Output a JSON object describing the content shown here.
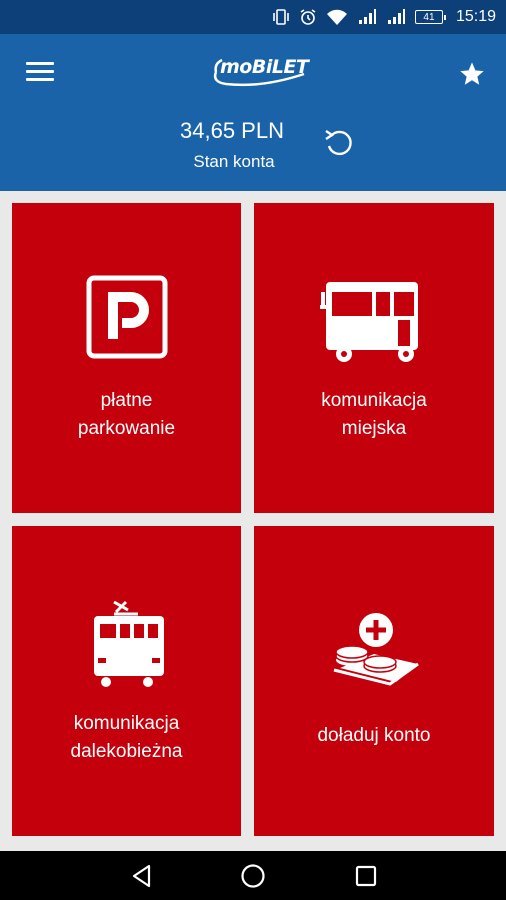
{
  "status_bar": {
    "time": "15:19",
    "battery": "41",
    "icons": [
      "vibrate-icon",
      "alarm-icon",
      "wifi-icon",
      "signal-icon",
      "signal-icon",
      "battery-icon"
    ]
  },
  "header": {
    "logo_text": "moBiLET",
    "balance": "34,65 PLN",
    "balance_label": "Stan konta",
    "menu_icon": "hamburger-menu-icon",
    "favorite_icon": "star-icon",
    "refresh_icon": "refresh-icon"
  },
  "tiles": [
    {
      "label": "płatne\nparkowanie",
      "icon": "parking-icon"
    },
    {
      "label": "komunikacja\nmiejska",
      "icon": "bus-icon"
    },
    {
      "label": "komunikacja\ndalekobieżna",
      "icon": "train-icon"
    },
    {
      "label": "doładuj konto",
      "icon": "coins-plus-icon"
    }
  ],
  "nav_bar": {
    "icons": [
      "back-icon",
      "home-icon",
      "recents-icon"
    ]
  },
  "colors": {
    "status_bar": "#0d3f79",
    "app_bar": "#1a63a9",
    "tile": "#c4000c",
    "background": "#e9e9ea"
  }
}
